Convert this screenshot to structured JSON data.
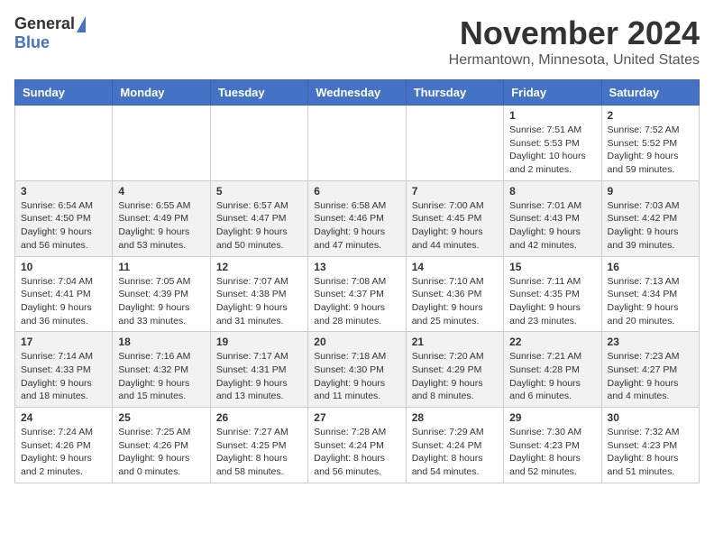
{
  "header": {
    "logo_general": "General",
    "logo_blue": "Blue",
    "month_title": "November 2024",
    "location": "Hermantown, Minnesota, United States"
  },
  "days_of_week": [
    "Sunday",
    "Monday",
    "Tuesday",
    "Wednesday",
    "Thursday",
    "Friday",
    "Saturday"
  ],
  "weeks": [
    [
      {
        "day": "",
        "info": ""
      },
      {
        "day": "",
        "info": ""
      },
      {
        "day": "",
        "info": ""
      },
      {
        "day": "",
        "info": ""
      },
      {
        "day": "",
        "info": ""
      },
      {
        "day": "1",
        "info": "Sunrise: 7:51 AM\nSunset: 5:53 PM\nDaylight: 10 hours and 2 minutes."
      },
      {
        "day": "2",
        "info": "Sunrise: 7:52 AM\nSunset: 5:52 PM\nDaylight: 9 hours and 59 minutes."
      }
    ],
    [
      {
        "day": "3",
        "info": "Sunrise: 6:54 AM\nSunset: 4:50 PM\nDaylight: 9 hours and 56 minutes."
      },
      {
        "day": "4",
        "info": "Sunrise: 6:55 AM\nSunset: 4:49 PM\nDaylight: 9 hours and 53 minutes."
      },
      {
        "day": "5",
        "info": "Sunrise: 6:57 AM\nSunset: 4:47 PM\nDaylight: 9 hours and 50 minutes."
      },
      {
        "day": "6",
        "info": "Sunrise: 6:58 AM\nSunset: 4:46 PM\nDaylight: 9 hours and 47 minutes."
      },
      {
        "day": "7",
        "info": "Sunrise: 7:00 AM\nSunset: 4:45 PM\nDaylight: 9 hours and 44 minutes."
      },
      {
        "day": "8",
        "info": "Sunrise: 7:01 AM\nSunset: 4:43 PM\nDaylight: 9 hours and 42 minutes."
      },
      {
        "day": "9",
        "info": "Sunrise: 7:03 AM\nSunset: 4:42 PM\nDaylight: 9 hours and 39 minutes."
      }
    ],
    [
      {
        "day": "10",
        "info": "Sunrise: 7:04 AM\nSunset: 4:41 PM\nDaylight: 9 hours and 36 minutes."
      },
      {
        "day": "11",
        "info": "Sunrise: 7:05 AM\nSunset: 4:39 PM\nDaylight: 9 hours and 33 minutes."
      },
      {
        "day": "12",
        "info": "Sunrise: 7:07 AM\nSunset: 4:38 PM\nDaylight: 9 hours and 31 minutes."
      },
      {
        "day": "13",
        "info": "Sunrise: 7:08 AM\nSunset: 4:37 PM\nDaylight: 9 hours and 28 minutes."
      },
      {
        "day": "14",
        "info": "Sunrise: 7:10 AM\nSunset: 4:36 PM\nDaylight: 9 hours and 25 minutes."
      },
      {
        "day": "15",
        "info": "Sunrise: 7:11 AM\nSunset: 4:35 PM\nDaylight: 9 hours and 23 minutes."
      },
      {
        "day": "16",
        "info": "Sunrise: 7:13 AM\nSunset: 4:34 PM\nDaylight: 9 hours and 20 minutes."
      }
    ],
    [
      {
        "day": "17",
        "info": "Sunrise: 7:14 AM\nSunset: 4:33 PM\nDaylight: 9 hours and 18 minutes."
      },
      {
        "day": "18",
        "info": "Sunrise: 7:16 AM\nSunset: 4:32 PM\nDaylight: 9 hours and 15 minutes."
      },
      {
        "day": "19",
        "info": "Sunrise: 7:17 AM\nSunset: 4:31 PM\nDaylight: 9 hours and 13 minutes."
      },
      {
        "day": "20",
        "info": "Sunrise: 7:18 AM\nSunset: 4:30 PM\nDaylight: 9 hours and 11 minutes."
      },
      {
        "day": "21",
        "info": "Sunrise: 7:20 AM\nSunset: 4:29 PM\nDaylight: 9 hours and 8 minutes."
      },
      {
        "day": "22",
        "info": "Sunrise: 7:21 AM\nSunset: 4:28 PM\nDaylight: 9 hours and 6 minutes."
      },
      {
        "day": "23",
        "info": "Sunrise: 7:23 AM\nSunset: 4:27 PM\nDaylight: 9 hours and 4 minutes."
      }
    ],
    [
      {
        "day": "24",
        "info": "Sunrise: 7:24 AM\nSunset: 4:26 PM\nDaylight: 9 hours and 2 minutes."
      },
      {
        "day": "25",
        "info": "Sunrise: 7:25 AM\nSunset: 4:26 PM\nDaylight: 9 hours and 0 minutes."
      },
      {
        "day": "26",
        "info": "Sunrise: 7:27 AM\nSunset: 4:25 PM\nDaylight: 8 hours and 58 minutes."
      },
      {
        "day": "27",
        "info": "Sunrise: 7:28 AM\nSunset: 4:24 PM\nDaylight: 8 hours and 56 minutes."
      },
      {
        "day": "28",
        "info": "Sunrise: 7:29 AM\nSunset: 4:24 PM\nDaylight: 8 hours and 54 minutes."
      },
      {
        "day": "29",
        "info": "Sunrise: 7:30 AM\nSunset: 4:23 PM\nDaylight: 8 hours and 52 minutes."
      },
      {
        "day": "30",
        "info": "Sunrise: 7:32 AM\nSunset: 4:23 PM\nDaylight: 8 hours and 51 minutes."
      }
    ]
  ]
}
